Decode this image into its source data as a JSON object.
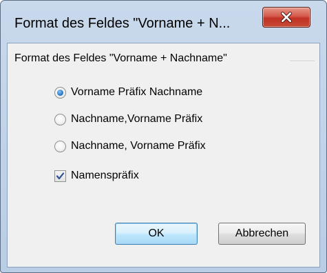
{
  "window": {
    "title": "Format des Feldes \"Vorname + N...",
    "close_icon": "close-icon"
  },
  "group": {
    "label": "Format des Feldes \"Vorname + Nachname\""
  },
  "options": [
    {
      "label": "Vorname Präfix Nachname",
      "checked": true
    },
    {
      "label": "Nachname,Vorname Präfix",
      "checked": false
    },
    {
      "label": "Nachname, Vorname Präfix",
      "checked": false
    }
  ],
  "checkbox": {
    "label": "Namenspräfix",
    "checked": true
  },
  "buttons": {
    "ok_label": "OK",
    "cancel_label": "Abbrechen"
  },
  "colors": {
    "titlebar": "#c9d9ec",
    "client_bg": "#f0f0f0",
    "close_button": "#c03324",
    "radio_dot": "#2a78c8",
    "default_button_border": "#3c7fb1"
  }
}
